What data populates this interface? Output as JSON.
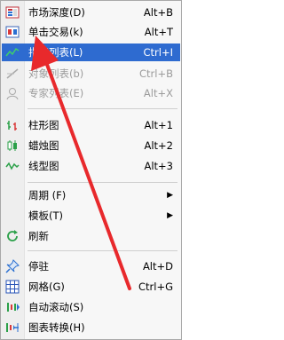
{
  "menu": {
    "market_depth": {
      "label": "市场深度(D)",
      "shortcut": "Alt+B"
    },
    "one_click": {
      "label": "单击交易(k)",
      "shortcut": "Alt+T"
    },
    "indicator_list": {
      "label": "指标列表(L)",
      "shortcut": "Ctrl+I"
    },
    "object_list": {
      "label": "对象列表(b)",
      "shortcut": "Ctrl+B"
    },
    "expert_list": {
      "label": "专家列表(E)",
      "shortcut": "Alt+X"
    },
    "bar_chart": {
      "label": "柱形图",
      "shortcut": "Alt+1"
    },
    "candle_chart": {
      "label": "蜡烛图",
      "shortcut": "Alt+2"
    },
    "line_chart": {
      "label": "线型图",
      "shortcut": "Alt+3"
    },
    "period": {
      "label": "周期 (F)"
    },
    "template": {
      "label": "模板(T)"
    },
    "refresh": {
      "label": "刷新"
    },
    "dock": {
      "label": "停驻",
      "shortcut": "Alt+D"
    },
    "grid": {
      "label": "网格(G)",
      "shortcut": "Ctrl+G"
    },
    "auto_scroll": {
      "label": "自动滚动(S)"
    },
    "chart_shift": {
      "label": "图表转换(H)"
    }
  },
  "colors": {
    "highlight": "#2e6bd0",
    "annotation_arrow": "#e8292c"
  },
  "icons": {
    "market_depth": "market-depth-icon",
    "one_click": "one-click-trading-icon",
    "indicator_list": "indicator-list-icon",
    "object_list": "object-list-icon",
    "expert_list": "expert-list-icon",
    "bar_chart": "bar-chart-icon",
    "candle_chart": "candlestick-icon",
    "line_chart": "line-chart-icon",
    "refresh": "refresh-icon",
    "dock": "pin-icon",
    "grid": "grid-icon",
    "auto_scroll": "auto-scroll-icon",
    "chart_shift": "chart-shift-icon"
  }
}
